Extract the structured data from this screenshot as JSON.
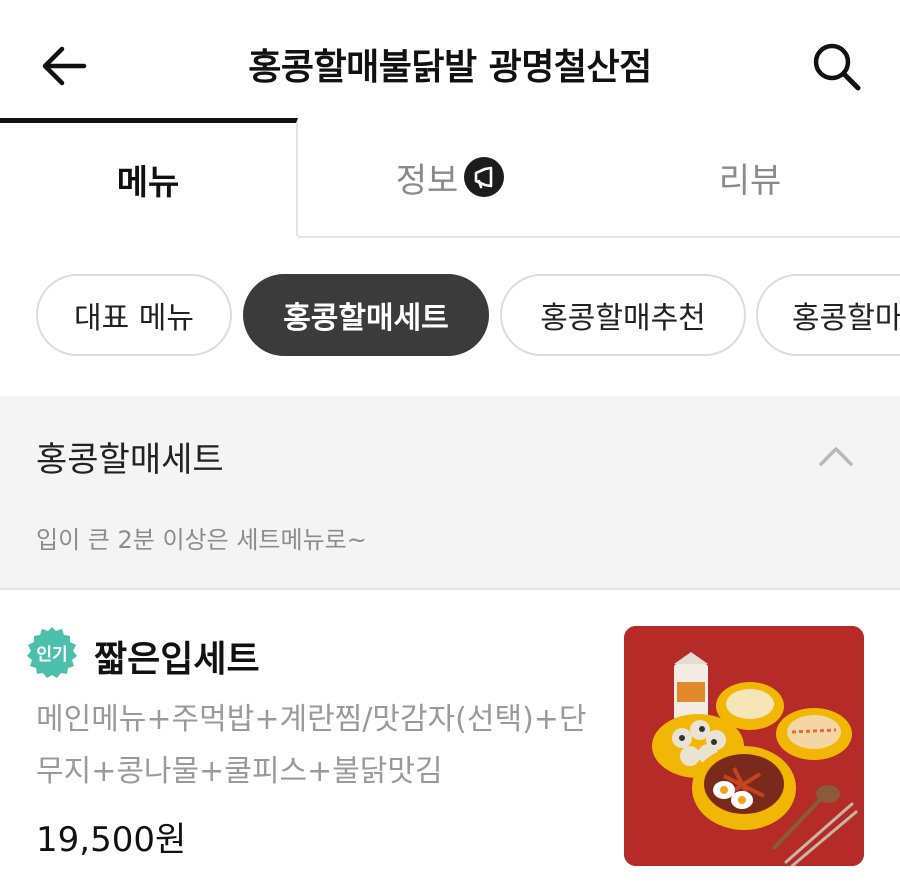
{
  "header": {
    "title": "홍콩할매불닭발 광명철산점"
  },
  "tabs": [
    {
      "label": "메뉴"
    },
    {
      "label": "정보"
    },
    {
      "label": "리뷰"
    }
  ],
  "chips": [
    {
      "label": "대표 메뉴"
    },
    {
      "label": "홍콩할매세트"
    },
    {
      "label": "홍콩할매추천"
    },
    {
      "label": "홍콩할마"
    }
  ],
  "section": {
    "title": "홍콩할매세트",
    "subtitle": "입이 큰 2분 이상은 세트메뉴로~"
  },
  "item": {
    "badge": "인기",
    "name": "짧은입세트",
    "description": "메인메뉴+주먹밥+계란찜/맛감자(선택)+단무지+콩나물+쿨피스+불닭맛김",
    "price": "19,500원"
  },
  "colors": {
    "badge_green": "#4dbfad",
    "chip_selected": "#3b3b3b",
    "image_bg": "#b52b27",
    "bowl_yellow": "#f2b705"
  },
  "icons": [
    "back-arrow-icon",
    "search-icon",
    "megaphone-icon",
    "chevron-up-icon"
  ]
}
